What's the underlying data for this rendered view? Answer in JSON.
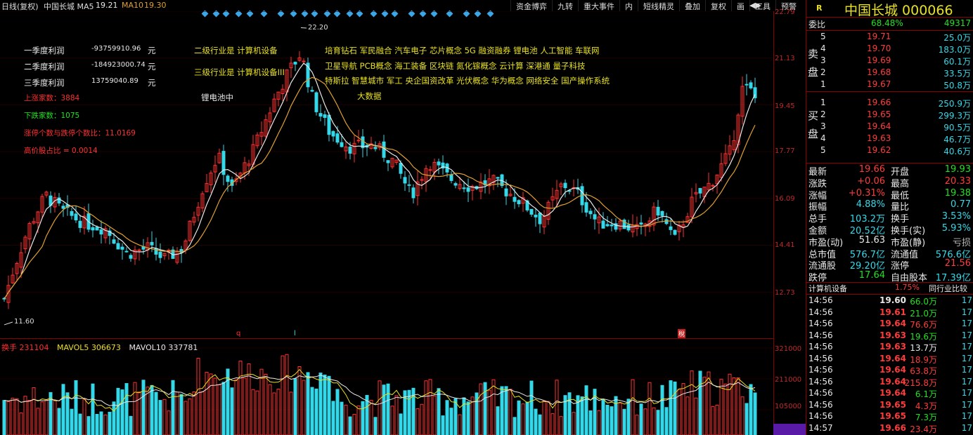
{
  "header": {
    "period": "日线(复权)",
    "stock_title": "中国长城 MA5",
    "ma5_value": "19.21",
    "ma10_label": "MA10",
    "ma10_value": "19.30"
  },
  "toolbar": [
    "资金博弈",
    "九转",
    "重大事件",
    "内",
    "短线精灵",
    "叠加",
    "复权",
    "画",
    "工具",
    "预警"
  ],
  "chart": {
    "price_axis": [
      "22.79",
      "21.13",
      "19.45",
      "17.77",
      "16.09",
      "14.41",
      "12.73"
    ],
    "volume_axis": [
      "321000",
      "211000",
      "105000"
    ],
    "max_label": "22.20",
    "min_label": "11.60",
    "date_markers": [
      "q",
      "l"
    ],
    "event_marker": "稅",
    "ma5_color": "#e8e8e8",
    "ma10_color": "#e0a030",
    "up_color": "#ff3030",
    "down_color": "#34d8e8"
  },
  "profits": [
    {
      "label": "一季度利润",
      "value": "-93759910.96",
      "unit": "元"
    },
    {
      "label": "二季度利润",
      "value": "-184923000.74",
      "unit": "元"
    },
    {
      "label": "三季度利润",
      "value": "13759040.89",
      "unit": "元"
    }
  ],
  "indicators": [
    {
      "text": "上涨家数：3884",
      "color": "#ff3030"
    },
    {
      "text": "下跌家数：1075",
      "color": "#20e020"
    },
    {
      "text": "涨停个数与跌停个数比：11.0169",
      "color": "#ff3030"
    },
    {
      "text": "高价股占比 = 0.0014",
      "color": "#ff3030"
    }
  ],
  "industry_tags": [
    "二级行业是 计算机设备",
    "三级行业是 计算机设备III"
  ],
  "sector_note": "锂电池中",
  "concept_lines": [
    "培育钻石 军民融合 汽车电子 芯片概念 5G 融资融券 锂电池 人工智能 车联网",
    "卫星导航 PCB概念 海工装备 区块链 氮化镓概念 云计算 深港通 量子科技",
    "特斯拉 智慧城市 军工 央企国资改革 光伏概念 华为概念 网络安全 国产操作系统",
    "大数据"
  ],
  "volume_header": {
    "label": "换手",
    "value": "231104",
    "mavol5_label": "MAVOL5",
    "mavol5_value": "306673",
    "mavol10_label": "MAVOL10",
    "mavol10_value": "337781"
  },
  "panel": {
    "title": "中国长城 000066",
    "weibi_label": "委比",
    "weibi_pct": "68.48%",
    "weibi_diff": "49317",
    "sell_label": "卖盘",
    "buy_label": "买盘",
    "asks": [
      {
        "level": "5",
        "price": "19.71",
        "vol": "25.0万"
      },
      {
        "level": "4",
        "price": "19.70",
        "vol": "183.0万"
      },
      {
        "level": "3",
        "price": "19.69",
        "vol": "60.1万"
      },
      {
        "level": "2",
        "price": "19.68",
        "vol": "33.5万"
      },
      {
        "level": "1",
        "price": "19.67",
        "vol": "50.8万"
      }
    ],
    "bids": [
      {
        "level": "1",
        "price": "19.66",
        "vol": "250.9万"
      },
      {
        "level": "2",
        "price": "19.65",
        "vol": "299.3万"
      },
      {
        "level": "3",
        "price": "19.64",
        "vol": "90.5万"
      },
      {
        "level": "4",
        "price": "19.63",
        "vol": "46.7万"
      },
      {
        "level": "5",
        "price": "19.62",
        "vol": "40.6万"
      }
    ],
    "stats": [
      {
        "l1": "最新",
        "v1": "19.66",
        "c1": "red",
        "l2": "开盘",
        "v2": "19.93",
        "c2": "green"
      },
      {
        "l1": "涨跌",
        "v1": "+0.06",
        "c1": "red",
        "l2": "最高",
        "v2": "20.33",
        "c2": "red"
      },
      {
        "l1": "涨幅",
        "v1": "+0.31%",
        "c1": "red",
        "l2": "最低",
        "v2": "19.38",
        "c2": "green"
      },
      {
        "l1": "振幅",
        "v1": "4.88%",
        "c1": "cyan",
        "l2": "量比",
        "v2": "0.77",
        "c2": "cyan"
      },
      {
        "l1": "总手",
        "v1": "103.2万",
        "c1": "cyan",
        "l2": "换手",
        "v2": "3.53%",
        "c2": "cyan"
      },
      {
        "l1": "金额",
        "v1": "20.52亿",
        "c1": "cyan",
        "l2": "换手(实)",
        "v2": "5.93%",
        "c2": "cyan"
      },
      {
        "l1": "市盈(动)",
        "v1": "51.63",
        "c1": "white",
        "l2": "市盈(静)",
        "v2": "亏损",
        "c2": "grey"
      },
      {
        "l1": "总市值",
        "v1": "576.7亿",
        "c1": "cyan",
        "l2": "流通值",
        "v2": "576.6亿",
        "c2": "cyan"
      },
      {
        "l1": "流通股",
        "v1": "29.20亿",
        "c1": "cyan",
        "l2": "涨停",
        "v2": "21.56",
        "c2": "red"
      },
      {
        "l1": "跌停",
        "v1": "17.64",
        "c1": "green",
        "l2": "自由股本",
        "v2": "17.39亿",
        "c2": "cyan"
      }
    ],
    "industry_label": "计算机设备",
    "industry_pct": "1.75%",
    "industry_link": "同行业比较",
    "trades": [
      {
        "time": "14:56",
        "price": "19.60",
        "vol": "66.0万",
        "n": "17",
        "pc": "white",
        "vc": "green"
      },
      {
        "time": "14:56",
        "price": "19.61",
        "vol": "21.0万",
        "n": "17",
        "pc": "red",
        "vc": "green"
      },
      {
        "time": "14:56",
        "price": "19.64",
        "vol": "76.6万",
        "n": "17",
        "pc": "red",
        "vc": "red"
      },
      {
        "time": "14:56",
        "price": "19.63",
        "vol": "19.6万",
        "n": "17",
        "pc": "red",
        "vc": "green"
      },
      {
        "time": "14:56",
        "price": "19.63",
        "vol": "13.7万",
        "n": "17",
        "pc": "red",
        "vc": "white"
      },
      {
        "time": "14:56",
        "price": "19.64",
        "vol": "18.9万",
        "n": "17",
        "pc": "red",
        "vc": "red"
      },
      {
        "time": "14:56",
        "price": "19.64",
        "vol": "63.8万",
        "n": "17",
        "pc": "red",
        "vc": "red"
      },
      {
        "time": "14:56",
        "price": "19.64",
        "vol": "215.8万",
        "n": "17",
        "pc": "red",
        "vc": "red"
      },
      {
        "time": "14:56",
        "price": "19.64",
        "vol": "6.1万",
        "n": "17",
        "pc": "red",
        "vc": "green"
      },
      {
        "time": "14:56",
        "price": "19.65",
        "vol": "4.3万",
        "n": "17",
        "pc": "red",
        "vc": "red"
      },
      {
        "time": "14:56",
        "price": "19.65",
        "vol": "7.3万",
        "n": "17",
        "pc": "red",
        "vc": "green"
      },
      {
        "time": "14:57",
        "price": "19.66",
        "vol": "23.4万",
        "n": "17",
        "pc": "red",
        "vc": "red"
      }
    ]
  }
}
